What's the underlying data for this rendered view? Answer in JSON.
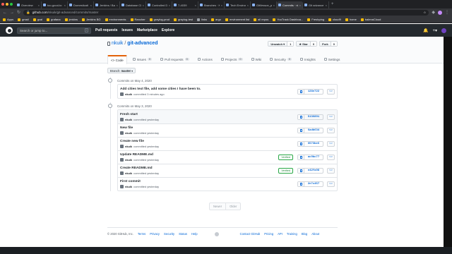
{
  "browser": {
    "tabs": [
      {
        "label": "Overview",
        "active": false
      },
      {
        "label": "too-good-to",
        "active": false
      },
      {
        "label": "Domesticati",
        "active": false
      },
      {
        "label": "Jenkins / Ba",
        "active": false
      },
      {
        "label": "Database Ch",
        "active": false
      },
      {
        "label": "Controlled D",
        "active": false
      },
      {
        "label": "7-4039",
        "active": false
      },
      {
        "label": "Branches · K",
        "active": false
      },
      {
        "label": "Tech Environ",
        "active": false
      },
      {
        "label": "Git/lesson_pl",
        "active": false
      },
      {
        "label": "Commits · nk",
        "active": true
      },
      {
        "label": "Git advance",
        "active": false
      }
    ],
    "url_host": "github.com",
    "url_path": "/nkuik/git-advanced/commits/master",
    "bookmarks": [
      {
        "label": "Apps",
        "folder": false
      },
      {
        "label": "gmail",
        "folder": false
      },
      {
        "label": "gcal",
        "folder": false
      },
      {
        "label": "grafana",
        "folder": false
      },
      {
        "label": "jenkins",
        "folder": false
      },
      {
        "label": "Jenkins BG",
        "folder": false
      },
      {
        "label": "environments",
        "folder": false
      },
      {
        "label": "Rancher",
        "folder": false
      },
      {
        "label": "graylog-prod",
        "folder": false
      },
      {
        "label": "graylog-test",
        "folder": false
      },
      {
        "label": "links",
        "folder": true
      },
      {
        "label": "argo",
        "folder": false
      },
      {
        "label": "environment list",
        "folder": false
      },
      {
        "label": "all repos",
        "folder": false
      },
      {
        "label": "YouTrack Dashboa...",
        "folder": false
      },
      {
        "label": "Freshping",
        "folder": false
      },
      {
        "label": "cloud9",
        "folder": false
      },
      {
        "label": "home",
        "folder": false
      },
      {
        "label": "balenaCloud",
        "folder": false
      }
    ]
  },
  "header": {
    "search_placeholder": "Search or jump to...",
    "search_key": "/",
    "nav": [
      "Pull requests",
      "Issues",
      "Marketplace",
      "Explore"
    ]
  },
  "repo": {
    "owner": "nkuik",
    "separator": "/",
    "name": "git-advanced",
    "watch": {
      "label": "Unwatch ▾",
      "count": "1"
    },
    "star": {
      "label": "★ Star",
      "count": "0"
    },
    "fork": {
      "label": "Fork",
      "count": "0"
    },
    "tabs": [
      {
        "label": "<> Code",
        "badge": "",
        "selected": true
      },
      {
        "label": "Issues",
        "badge": "0",
        "selected": false
      },
      {
        "label": "Pull requests",
        "badge": "0",
        "selected": false
      },
      {
        "label": "Actions",
        "badge": "",
        "selected": false
      },
      {
        "label": "Projects",
        "badge": "0",
        "selected": false
      },
      {
        "label": "Wiki",
        "badge": "",
        "selected": false
      },
      {
        "label": "Security",
        "badge": "0",
        "selected": false
      },
      {
        "label": "Insights",
        "badge": "",
        "selected": false
      },
      {
        "label": "Settings",
        "badge": "",
        "selected": false
      }
    ]
  },
  "branch": {
    "prefix": "Branch:",
    "name": "master",
    "caret": "▾"
  },
  "groups": [
    {
      "heading": "Commits on May 4, 2020",
      "commits": [
        {
          "title": "Add cities text file, add some cities I have been to.",
          "author": "nkuik",
          "when": "committed 3 minutes ago",
          "verified": "",
          "sha": "128e722"
        }
      ]
    },
    {
      "heading": "Commits on May 3, 2020",
      "commits": [
        {
          "title": "Fresh start",
          "author": "nkuik",
          "when": "committed yesterday",
          "verified": "",
          "sha": "5136891"
        },
        {
          "title": "New file",
          "author": "nkuik",
          "when": "committed yesterday",
          "verified": "",
          "sha": "6adb634"
        },
        {
          "title": "Create new file",
          "author": "nkuik",
          "when": "committed yesterday",
          "verified": "",
          "sha": "6573be6"
        },
        {
          "title": "Update README.md",
          "author": "nkuik",
          "when": "committed yesterday",
          "verified": "Verified",
          "sha": "ac9bc77"
        },
        {
          "title": "Create README.md",
          "author": "nkuik",
          "when": "committed yesterday",
          "verified": "Verified",
          "sha": "e42fa98"
        },
        {
          "title": "First commit",
          "author": "nkuik",
          "when": "committed yesterday",
          "verified": "",
          "sha": "2e7c457"
        }
      ]
    }
  ],
  "pagination": {
    "newer": "Newer",
    "older": "Older"
  },
  "footer": {
    "copyright": "© 2020 GitHub, Inc.",
    "links": [
      "Terms",
      "Privacy",
      "Security",
      "Status",
      "Help"
    ],
    "links_right": [
      "Contact GitHub",
      "Pricing",
      "API",
      "Training",
      "Blog",
      "About"
    ]
  },
  "colors": {
    "accent_link": "#0366d6",
    "header_bg": "#24292e",
    "selected_tab_border": "#e36209",
    "verified": "#22863a"
  }
}
